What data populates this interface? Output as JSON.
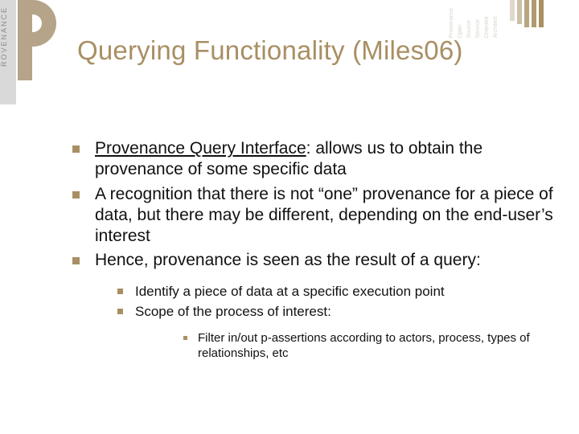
{
  "brand": {
    "rail_text": "ROVENANCE"
  },
  "top_right_labels": [
    "Provenance",
    "Open",
    "Source",
    "Service",
    "Oriented",
    "Architect"
  ],
  "title": "Querying Functionality (Miles06)",
  "bullets": [
    {
      "lead": "Provenance Query Interface",
      "rest": ": allows us to obtain the provenance of some specific data"
    },
    {
      "lead": "",
      "rest": "A recognition that there is not “one” provenance for a piece of data, but there may be different, depending on the end-user’s interest"
    },
    {
      "lead": "",
      "rest": "Hence, provenance is seen as the result of a query:"
    }
  ],
  "sub_bullets": [
    "Identify a piece of data at a specific execution point",
    "Scope of the process of interest:"
  ],
  "sub_sub_bullets": [
    "Filter in/out p-assertions according to actors, process, types of relationships, etc"
  ]
}
